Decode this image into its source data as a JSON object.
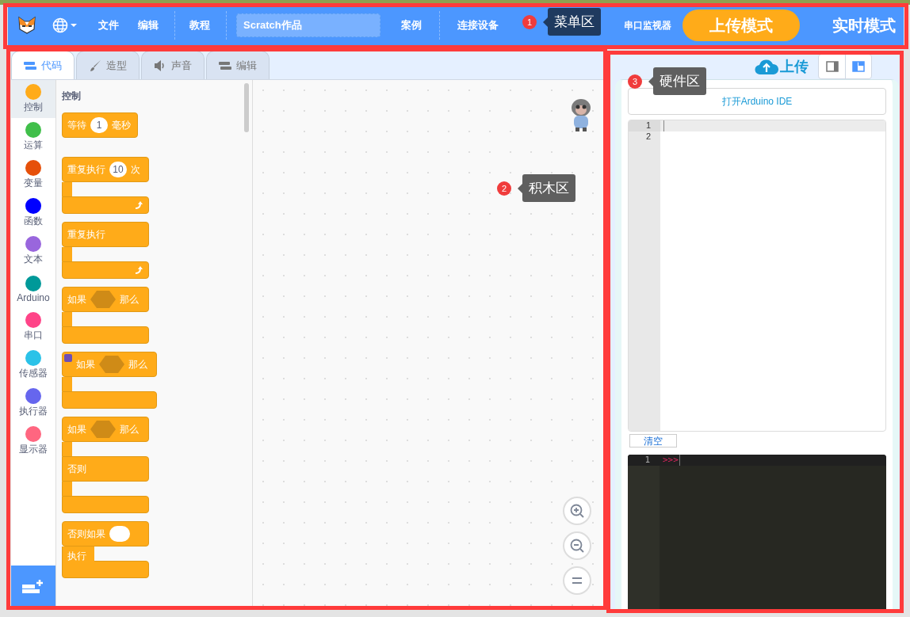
{
  "menu_bar": {
    "items_left": [
      "文件",
      "编辑"
    ],
    "tutorial": "教程",
    "project_title": {
      "value": "Scratch作品"
    },
    "items_right": [
      "案例",
      "连接设备"
    ],
    "serial_monitor": "串口监视器",
    "modes": [
      {
        "label": "上传模式",
        "selected": true
      },
      {
        "label": "实时模式",
        "selected": false
      }
    ]
  },
  "tabs": [
    {
      "label": "代码",
      "kind": "code",
      "selected": true
    },
    {
      "label": "造型",
      "kind": "brush",
      "selected": false
    },
    {
      "label": "声音",
      "kind": "sound",
      "selected": false
    },
    {
      "label": "编辑",
      "kind": "code",
      "selected": false
    }
  ],
  "categories": [
    {
      "label": "控制",
      "color": "#ffab19",
      "selected": true
    },
    {
      "label": "运算",
      "color": "#40bf4a",
      "selected": false
    },
    {
      "label": "变量",
      "color": "#e6500a",
      "selected": false
    },
    {
      "label": "函数",
      "color": "#0000ff",
      "selected": false
    },
    {
      "label": "文本",
      "color": "#9966dd",
      "selected": false
    },
    {
      "label": "Arduino",
      "color": "#009999",
      "selected": false
    },
    {
      "label": "串口",
      "color": "#ff4488",
      "selected": false
    },
    {
      "label": "传感器",
      "color": "#2bc2e8",
      "selected": false
    },
    {
      "label": "执行器",
      "color": "#6666ee",
      "selected": false
    },
    {
      "label": "显示器",
      "color": "#ff6680",
      "selected": false
    }
  ],
  "palette": {
    "heading": "控制",
    "blocks": [
      {
        "kind": "stack",
        "before": "等待",
        "input": "1",
        "after": "毫秒"
      },
      {
        "kind": "loop",
        "before": "重复执行",
        "input": "10",
        "after": "次"
      },
      {
        "kind": "loop",
        "before": "重复执行"
      },
      {
        "kind": "if",
        "before": "如果",
        "after": "那么"
      },
      {
        "kind": "if",
        "before": "如果",
        "after": "那么",
        "extension": true
      },
      {
        "kind": "if_else",
        "before": "如果",
        "after": "那么",
        "else": "否则"
      },
      {
        "kind": "else_if",
        "before": "否则如果",
        "body": "执行"
      }
    ]
  },
  "hardware": {
    "upload": "上传",
    "open_ide": "打开Arduino IDE",
    "code_lines": [
      "1",
      "2"
    ],
    "clear": "清空",
    "console_lines": [
      {
        "number": "1",
        "prompt": ">>>"
      }
    ]
  },
  "annotations": [
    {
      "number": "1",
      "label": "菜单区",
      "color": "#1f3a5f"
    },
    {
      "number": "2",
      "label": "积木区",
      "color": "#5f5f5f"
    },
    {
      "number": "3",
      "label": "硬件区",
      "color": "#5f5f5f"
    }
  ]
}
